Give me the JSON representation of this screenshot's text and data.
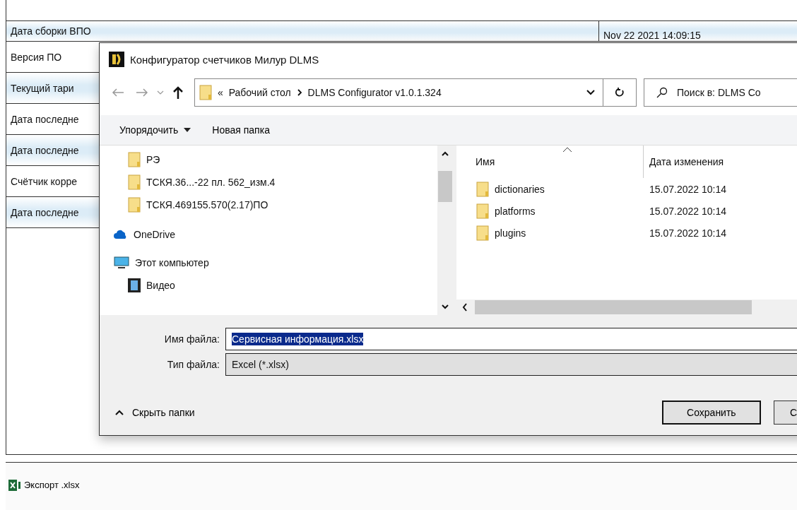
{
  "table": {
    "rows": [
      {
        "label": "Дата сборки ВПО",
        "value": "Nov 22 2021 14:09:15"
      },
      {
        "label": "Версия ПО"
      },
      {
        "label": "Текущий тари"
      },
      {
        "label": "Дата последне"
      },
      {
        "label": "Дата последне"
      },
      {
        "label": "Счётчик корре"
      },
      {
        "label": "Дата последне"
      }
    ]
  },
  "dialog": {
    "title": "Конфигуратор счетчиков Милур DLMS",
    "path_prefix": "«",
    "path": [
      "Рабочий стол",
      "DLMS Configurator v1.0.1.324"
    ],
    "search": {
      "placeholder": "Поиск в: DLMS Co"
    },
    "toolbar": [
      "Упорядочить",
      "Новая папка"
    ],
    "tree": [
      {
        "label": "РЭ",
        "kind": "folder"
      },
      {
        "label": "ТСКЯ.36...-22 пл. 562_изм.4",
        "kind": "folder"
      },
      {
        "label": "ТСКЯ.469155.570(2.17)ПО",
        "kind": "folder"
      },
      {
        "label": "OneDrive",
        "kind": "cloud"
      },
      {
        "label": "Этот компьютер",
        "kind": "computer",
        "children": [
          {
            "label": "Видео",
            "kind": "video"
          }
        ]
      }
    ],
    "columns": [
      "Имя",
      "Дата изменения"
    ],
    "files": [
      {
        "name": "dictionaries",
        "modified": "15.07.2022 10:14"
      },
      {
        "name": "platforms",
        "modified": "15.07.2022 10:14"
      },
      {
        "name": "plugins",
        "modified": "15.07.2022 10:14"
      }
    ],
    "file_name": {
      "label": "Имя файла:",
      "value": "Сервисная информация.xlsx"
    },
    "file_type": {
      "label": "Тип файла:",
      "value": "Excel (*.xlsx)"
    },
    "hide_folders": "Скрыть папки",
    "buttons": [
      "Сохранить",
      "С"
    ]
  },
  "footer": {
    "export_button": "Экспорт .xlsx"
  }
}
